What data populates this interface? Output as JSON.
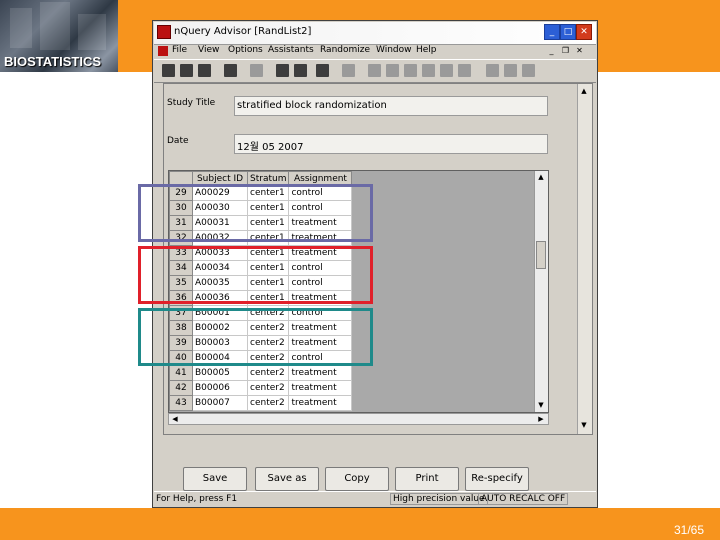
{
  "slide": {
    "logo_text": "BIOSTATISTICS",
    "page_number": "31/65",
    "bar_color": "#f7941d"
  },
  "window": {
    "title": "nQuery Advisor    [RandList2]",
    "min_icon": "minimize-icon",
    "max_icon": "maximize-icon",
    "close_icon": "close-icon"
  },
  "menu": [
    "File",
    "View",
    "Options",
    "Assistants",
    "Randomize",
    "Window",
    "Help"
  ],
  "form": {
    "study_title_label": "Study Title",
    "study_title_value": "stratified block randomization",
    "date_label": "Date",
    "date_value": "12월 05 2007"
  },
  "table": {
    "columns": [
      "Subject ID",
      "Stratum",
      "Assignment"
    ],
    "rows": [
      {
        "n": "29",
        "id": "A00029",
        "stratum": "center1",
        "assignment": "control"
      },
      {
        "n": "30",
        "id": "A00030",
        "stratum": "center1",
        "assignment": "control"
      },
      {
        "n": "31",
        "id": "A00031",
        "stratum": "center1",
        "assignment": "treatment"
      },
      {
        "n": "32",
        "id": "A00032",
        "stratum": "center1",
        "assignment": "treatment"
      },
      {
        "n": "33",
        "id": "A00033",
        "stratum": "center1",
        "assignment": "treatment"
      },
      {
        "n": "34",
        "id": "A00034",
        "stratum": "center1",
        "assignment": "control"
      },
      {
        "n": "35",
        "id": "A00035",
        "stratum": "center1",
        "assignment": "control"
      },
      {
        "n": "36",
        "id": "A00036",
        "stratum": "center1",
        "assignment": "treatment"
      },
      {
        "n": "37",
        "id": "B00001",
        "stratum": "center2",
        "assignment": "control"
      },
      {
        "n": "38",
        "id": "B00002",
        "stratum": "center2",
        "assignment": "treatment"
      },
      {
        "n": "39",
        "id": "B00003",
        "stratum": "center2",
        "assignment": "treatment"
      },
      {
        "n": "40",
        "id": "B00004",
        "stratum": "center2",
        "assignment": "control"
      },
      {
        "n": "41",
        "id": "B00005",
        "stratum": "center2",
        "assignment": "treatment"
      },
      {
        "n": "42",
        "id": "B00006",
        "stratum": "center2",
        "assignment": "treatment"
      },
      {
        "n": "43",
        "id": "B00007",
        "stratum": "center2",
        "assignment": "treatment"
      }
    ]
  },
  "highlights": [
    {
      "color": "#6a6aa6"
    },
    {
      "color": "#e0202a"
    },
    {
      "color": "#1f8a8a"
    }
  ],
  "buttons": {
    "save": "Save",
    "save_as": "Save as",
    "copy": "Copy",
    "print": "Print",
    "respecify": "Re-specify"
  },
  "status": {
    "help": "For Help, press F1",
    "mode": "High precision value",
    "recalc": "AUTO RECALC OFF"
  }
}
